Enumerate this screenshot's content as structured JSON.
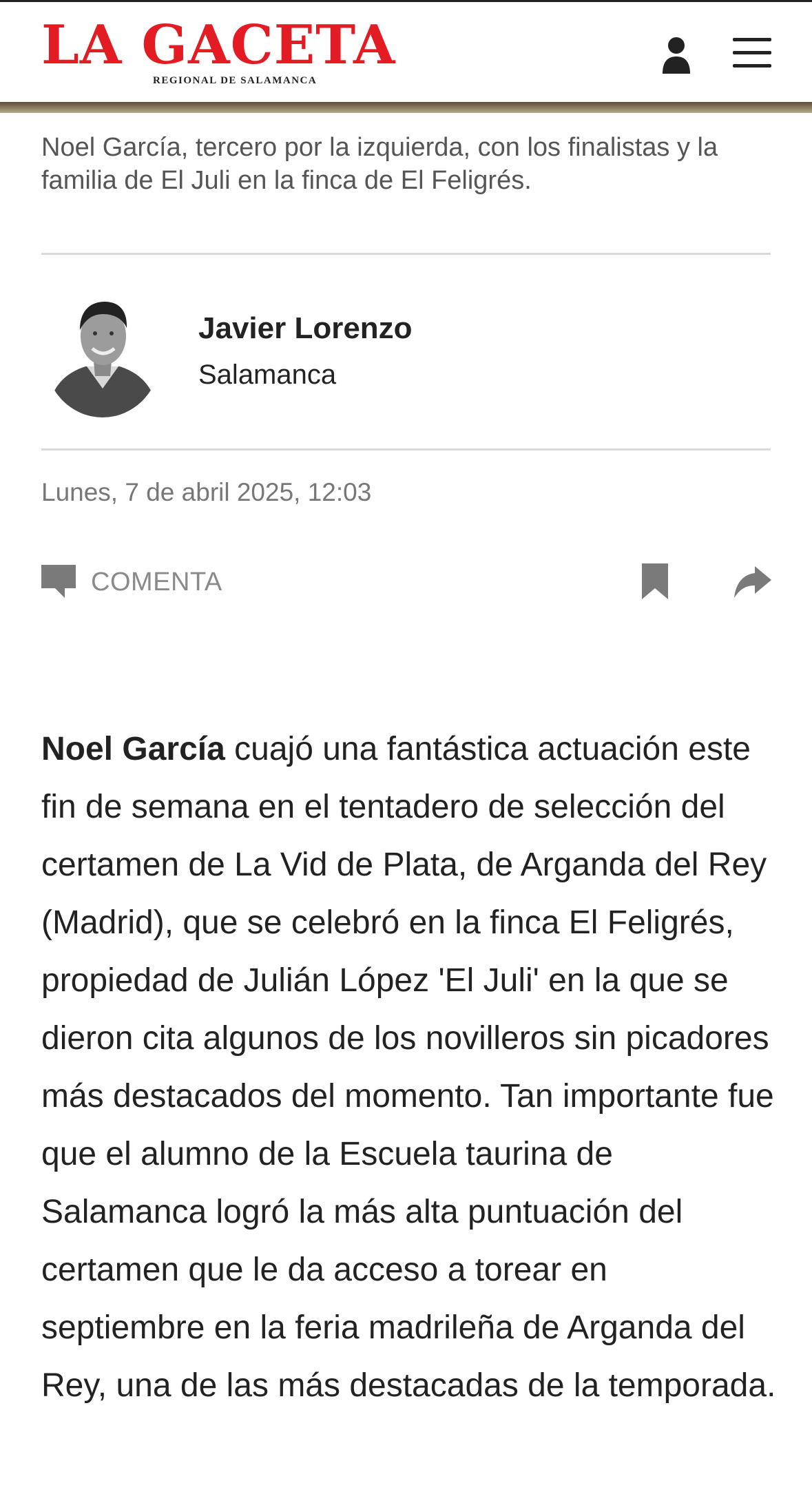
{
  "header": {
    "logo_title": "LA GACETA",
    "logo_subtitle": "REGIONAL DE SALAMANCA",
    "brand_color": "#e31b23",
    "user_icon": "user-icon",
    "menu_icon": "hamburger-menu-icon"
  },
  "photo": {
    "caption": "Noel García, tercero por la izquierda, con los finalistas y la familia de El Juli en la finca de El Feligrés."
  },
  "author": {
    "name": "Javier Lorenzo",
    "location": "Salamanca"
  },
  "date": "Lunes, 7 de abril 2025, 12:03",
  "actions": {
    "comment_label": "COMENTA",
    "comment_icon": "comment-icon",
    "bookmark_icon": "bookmark-icon",
    "share_icon": "share-icon"
  },
  "article": {
    "lead_bold": "Noel García",
    "body": " cuajó una fantástica actuación este fin de semana en el tentadero de selección del certamen de La Vid de Plata, de Arganda del Rey (Madrid), que se celebró en la finca El Feligrés, propiedad de Julián López 'El Juli' en la que se dieron cita algunos de los novilleros sin picadores más destacados del momento. Tan importante fue que el alumno de la Escuela taurina de Salamanca logró la más alta puntuación del certamen que le da acceso a torear en septiembre en la feria madrileña de Arganda del Rey, una de las más destacadas de la temporada."
  }
}
